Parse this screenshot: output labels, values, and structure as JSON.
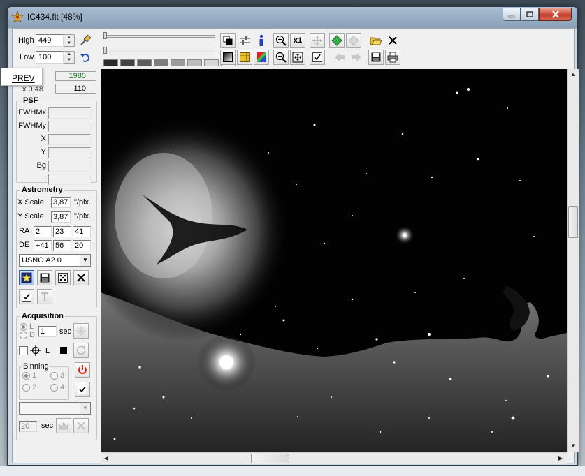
{
  "window": {
    "title": "IC434.fit  [48%]"
  },
  "toolbar": {
    "high_label": "High",
    "high_value": "449",
    "low_label": "Low",
    "low_value": "100",
    "zoom_1x_label": "x1",
    "icons": [
      "brush-icon",
      "undo-icon",
      "copy-icon",
      "adjust-icon",
      "info-icon",
      "zoom-in-icon",
      "zoom-1x",
      "move-icon",
      "shape-icon",
      "dotted-shape-icon",
      "open-folder-icon",
      "close-icon",
      "gradient-icon",
      "grid-icon",
      "palette-icon",
      "zoom-out-icon",
      "fit-icon",
      "check-icon",
      "arrow-left-icon",
      "arrow-right-icon",
      "save-icon",
      "print-icon"
    ],
    "swatch_colors": [
      "#2a2a2a",
      "#444444",
      "#5e5e5e",
      "#7d7d7d",
      "#9a9a9a",
      "#bcbcbc",
      "#d8d8d8",
      "#f2f2f2"
    ]
  },
  "readout": {
    "value1": "1985",
    "value2_prefix": "x 0,48",
    "value2": "110",
    "popup_label": "PREV"
  },
  "psf": {
    "title": "PSF",
    "rows": [
      "FWHMx",
      "FWHMy",
      "X",
      "Y",
      "Bg",
      "I"
    ]
  },
  "astrometry": {
    "title": "Astrometry",
    "xscale_label": "X Scale",
    "xscale_value": "3,87",
    "xscale_unit": "\"/pix.",
    "yscale_label": "Y Scale",
    "yscale_value": "3,87",
    "yscale_unit": "\"/pix.",
    "ra_label": "RA",
    "ra": [
      "2",
      "23",
      "41"
    ],
    "de_label": "DE",
    "de": [
      "+41",
      "56",
      "20"
    ],
    "catalog": "USNO A2.0"
  },
  "acquisition": {
    "title": "Acquisition",
    "radio_l": "L",
    "radio_d": "D",
    "exposure": "1",
    "exposure_unit": "sec",
    "l_button": "L",
    "binning_title": "Binning",
    "binning": [
      "1",
      "3",
      "2",
      "4"
    ],
    "interval": "20",
    "interval_unit": "sec"
  },
  "colors": {
    "accent": "#2d5fa8",
    "power": "#cc2a1a",
    "info": "#1f3fbf"
  }
}
